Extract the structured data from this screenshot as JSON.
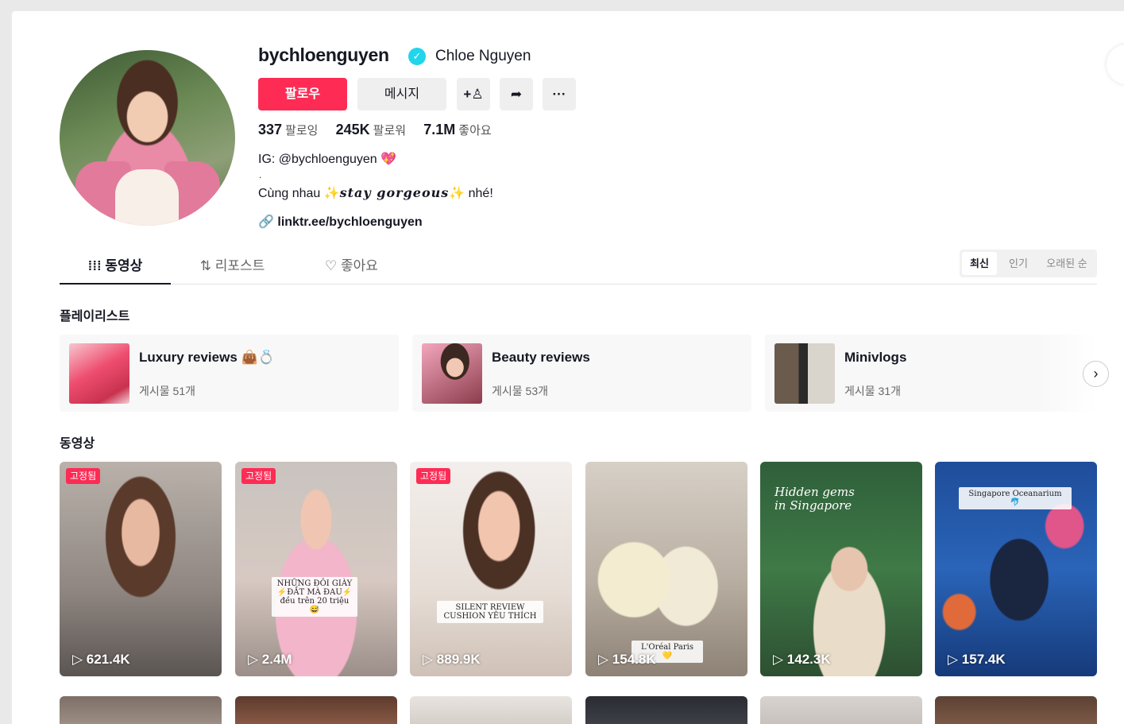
{
  "profile": {
    "username": "bychloenguyen",
    "display_name": "Chloe Nguyen",
    "verified_glyph": "✓",
    "follow_label": "팔로우",
    "message_label": "메시지",
    "add_user_glyph": "+♙",
    "share_glyph": "➦",
    "more_glyph": "···",
    "stats": {
      "following_count": "337",
      "following_label": "팔로잉",
      "followers_count": "245K",
      "followers_label": "팔로워",
      "likes_count": "7.1M",
      "likes_label": "좋아요"
    },
    "bio_line1": "IG: @bychloenguyen 💖",
    "bio_dot": ".",
    "bio_line2_pre": "Cùng nhau ",
    "bio_spark": "✨",
    "bio_fancy": "stay gorgeous",
    "bio_line2_post": " nhé!",
    "link": "linktr.ee/bychloenguyen",
    "link_glyph": "🔗"
  },
  "tabs": {
    "videos": "⁞⁞⁞ 동영상",
    "reposts": "⇅ 리포스트",
    "liked": "♡ 좋아요"
  },
  "sort": {
    "latest": "최신",
    "popular": "인기",
    "oldest": "오래된 순"
  },
  "playlists_title": "플레이리스트",
  "playlists": [
    {
      "name": "Luxury reviews 👜💍",
      "count": "게시물 51개"
    },
    {
      "name": "Beauty reviews",
      "count": "게시물 53개"
    },
    {
      "name": "Minivlogs",
      "count": "게시물 31개"
    }
  ],
  "playlist_next": "›",
  "videos_title": "동영상",
  "videos": [
    {
      "pinned": "고정됨",
      "views": "▷ 621.4K"
    },
    {
      "pinned": "고정됨",
      "views": "▷ 2.4M",
      "caption": "NHỮNG ĐÔI GIÀY ⚡ĐẮT MÀ ĐAU⚡ đều trên 20 triệu 😅"
    },
    {
      "pinned": "고정됨",
      "views": "▷ 889.9K",
      "caption": "SILENT REVIEW CUSHION YÊU THÍCH"
    },
    {
      "views": "▷ 154.8K",
      "caption": "L'Oréal Paris 💛"
    },
    {
      "views": "▷ 142.3K",
      "caption": "Hidden gems in Singapore"
    },
    {
      "views": "▷ 157.4K",
      "caption": "Singapore Oceanarium 🐬"
    }
  ]
}
